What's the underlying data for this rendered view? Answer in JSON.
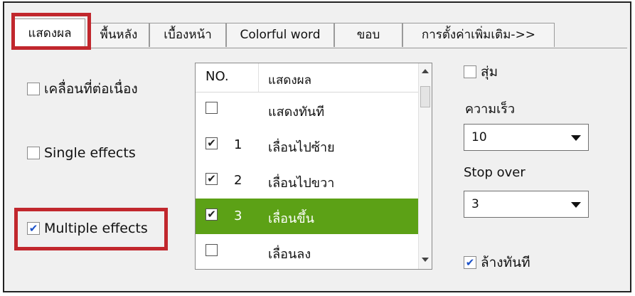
{
  "tabs": [
    {
      "label": "แสดงผล",
      "active": true
    },
    {
      "label": "พื้นหลัง",
      "active": false
    },
    {
      "label": "เบื้องหน้า",
      "active": false
    },
    {
      "label": "Colorful word",
      "active": false
    },
    {
      "label": "ขอบ",
      "active": false
    },
    {
      "label": "การตั้งค่าเพิ่มเติม->>",
      "active": false
    }
  ],
  "left_options": {
    "continuous": {
      "label": "เคลื่อนที่ต่อเนื่อง",
      "checked": false
    },
    "single": {
      "label": "Single effects",
      "checked": false
    },
    "multiple": {
      "label": "Multiple effects",
      "checked": true
    }
  },
  "effects_list": {
    "headers": {
      "no": "NO.",
      "display": "แสดงผล"
    },
    "rows": [
      {
        "checked": false,
        "no": "",
        "text": "แสดงทันที",
        "selected": false
      },
      {
        "checked": true,
        "no": "1",
        "text": "เลื่อนไปซ้าย",
        "selected": false
      },
      {
        "checked": true,
        "no": "2",
        "text": "เลื่อนไปขวา",
        "selected": false
      },
      {
        "checked": true,
        "no": "3",
        "text": "เลื่อนขึ้น",
        "selected": true
      },
      {
        "checked": false,
        "no": "",
        "text": "เลื่อนลง",
        "selected": false
      }
    ]
  },
  "right_panel": {
    "random": {
      "label": "สุ่ม",
      "checked": false
    },
    "speed": {
      "label": "ความเร็ว",
      "value": "10"
    },
    "stop_over": {
      "label": "Stop over",
      "value": "3"
    },
    "clear_now": {
      "label": "ล้างทันที",
      "checked": true
    }
  },
  "colors": {
    "selection": "#5ca116",
    "highlight_box": "#c1272d"
  }
}
